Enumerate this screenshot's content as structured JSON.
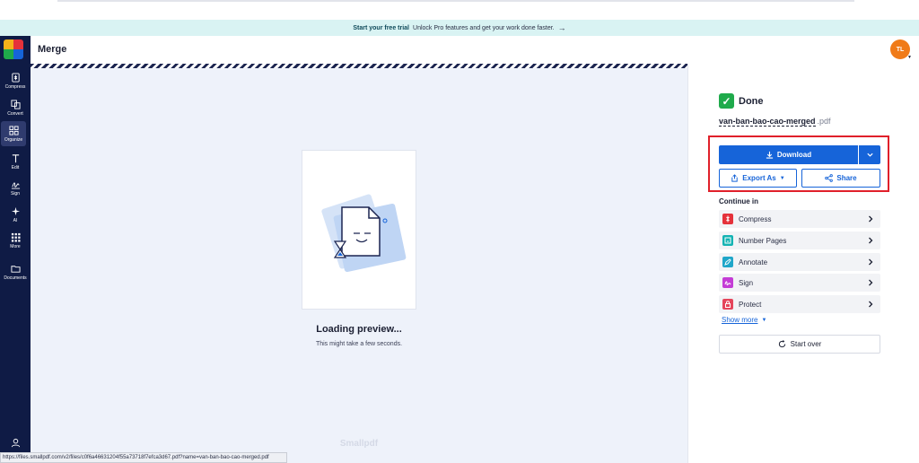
{
  "banner": {
    "bold": "Start your free trial",
    "text": "Unlock Pro features and get your work done faster.",
    "arrow": "→"
  },
  "sidebar": {
    "items": [
      {
        "label": "Compress",
        "icon": "compress-icon"
      },
      {
        "label": "Convert",
        "icon": "convert-icon"
      },
      {
        "label": "Organize",
        "icon": "organize-icon",
        "active": true
      },
      {
        "label": "Edit",
        "icon": "edit-text-icon"
      },
      {
        "label": "Sign",
        "icon": "sign-icon"
      },
      {
        "label": "AI",
        "icon": "ai-sparkle-icon"
      },
      {
        "label": "More",
        "icon": "grid-dots-icon"
      },
      {
        "label": "Documents",
        "icon": "folder-icon"
      }
    ],
    "user_icon": "user-icon"
  },
  "header": {
    "title": "Merge",
    "avatar_initials": "TL"
  },
  "preview": {
    "loading_title": "Loading preview...",
    "loading_sub": "This might take a few seconds.",
    "watermark": "Smallpdf"
  },
  "status_url": "https://files.smallpdf.com/v2/files/c0f6a46631204f55a73718f7efca3d67.pdf?name=van-ban-bao-cao-merged.pdf",
  "panel": {
    "done_label": "Done",
    "file_base": "van-ban-bao-cao-merged",
    "file_ext": ".pdf",
    "download_label": "Download",
    "export_label": "Export As",
    "share_label": "Share",
    "continue_title": "Continue in",
    "tools": [
      {
        "label": "Compress",
        "color": "#e5323b"
      },
      {
        "label": "Number Pages",
        "color": "#14b3b3"
      },
      {
        "label": "Annotate",
        "color": "#1fa6c9"
      },
      {
        "label": "Sign",
        "color": "#c43cd6"
      },
      {
        "label": "Protect",
        "color": "#e5455b"
      }
    ],
    "show_more": "Show more",
    "start_over": "Start over"
  },
  "colors": {
    "accent": "#1664d9",
    "sidebar": "#0f1b45",
    "done": "#1faa4b",
    "highlight": "#e0202a",
    "avatar": "#f07b18"
  }
}
